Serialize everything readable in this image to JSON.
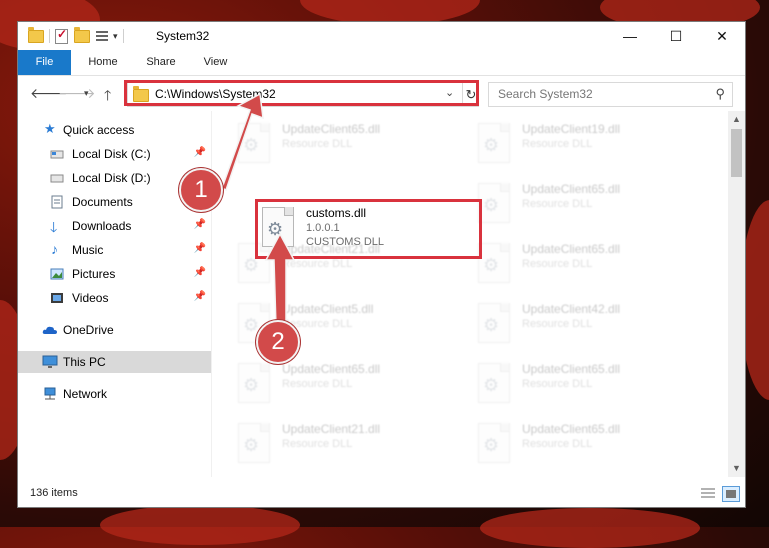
{
  "window": {
    "title": "System32",
    "minimize": "—",
    "maximize": "☐",
    "close": "✕"
  },
  "ribbon": {
    "tabs": [
      "File",
      "Home",
      "Share",
      "View"
    ]
  },
  "address": {
    "path": "C:\\Windows\\System32"
  },
  "search": {
    "placeholder": "Search System32"
  },
  "navigation": {
    "items": [
      {
        "label": "Quick access"
      },
      {
        "label": "Local Disk (C:)"
      },
      {
        "label": "Local Disk (D:)"
      },
      {
        "label": "Documents"
      },
      {
        "label": "Downloads"
      },
      {
        "label": "Music"
      },
      {
        "label": "Pictures"
      },
      {
        "label": "Videos"
      },
      {
        "label": "OneDrive"
      },
      {
        "label": "This PC"
      },
      {
        "label": "Network"
      }
    ]
  },
  "files": {
    "highlighted": {
      "name": "customs.dll",
      "version": "1.0.0.1",
      "description": "CUSTOMS DLL"
    },
    "background": [
      {
        "name": "UpdateClient65.dll",
        "type": "Resource DLL"
      },
      {
        "name": "UpdateClient19.dll",
        "type": "Resource DLL"
      },
      {
        "name": "UpdateClient65.dll",
        "type": "Resource DLL"
      },
      {
        "name": "UpdateClient21.dll",
        "type": "Resource DLL"
      },
      {
        "name": "UpdateClient65.dll",
        "type": "Resource DLL"
      },
      {
        "name": "UpdateClient5.dll",
        "type": "Resource DLL"
      },
      {
        "name": "UpdateClient42.dll",
        "type": "Resource DLL"
      },
      {
        "name": "UpdateClient65.dll",
        "type": "Resource DLL"
      },
      {
        "name": "UpdateClient65.dll",
        "type": "Resource DLL"
      },
      {
        "name": "UpdateClient21.dll",
        "type": "Resource DLL"
      },
      {
        "name": "UpdateClient65.dll",
        "type": "Resource DLL"
      }
    ]
  },
  "status": {
    "item_count": "136 items"
  },
  "callouts": [
    "1",
    "2"
  ],
  "colors": {
    "accent": "#1979ca",
    "highlight": "#d9323d",
    "callout": "#d24a4a"
  }
}
